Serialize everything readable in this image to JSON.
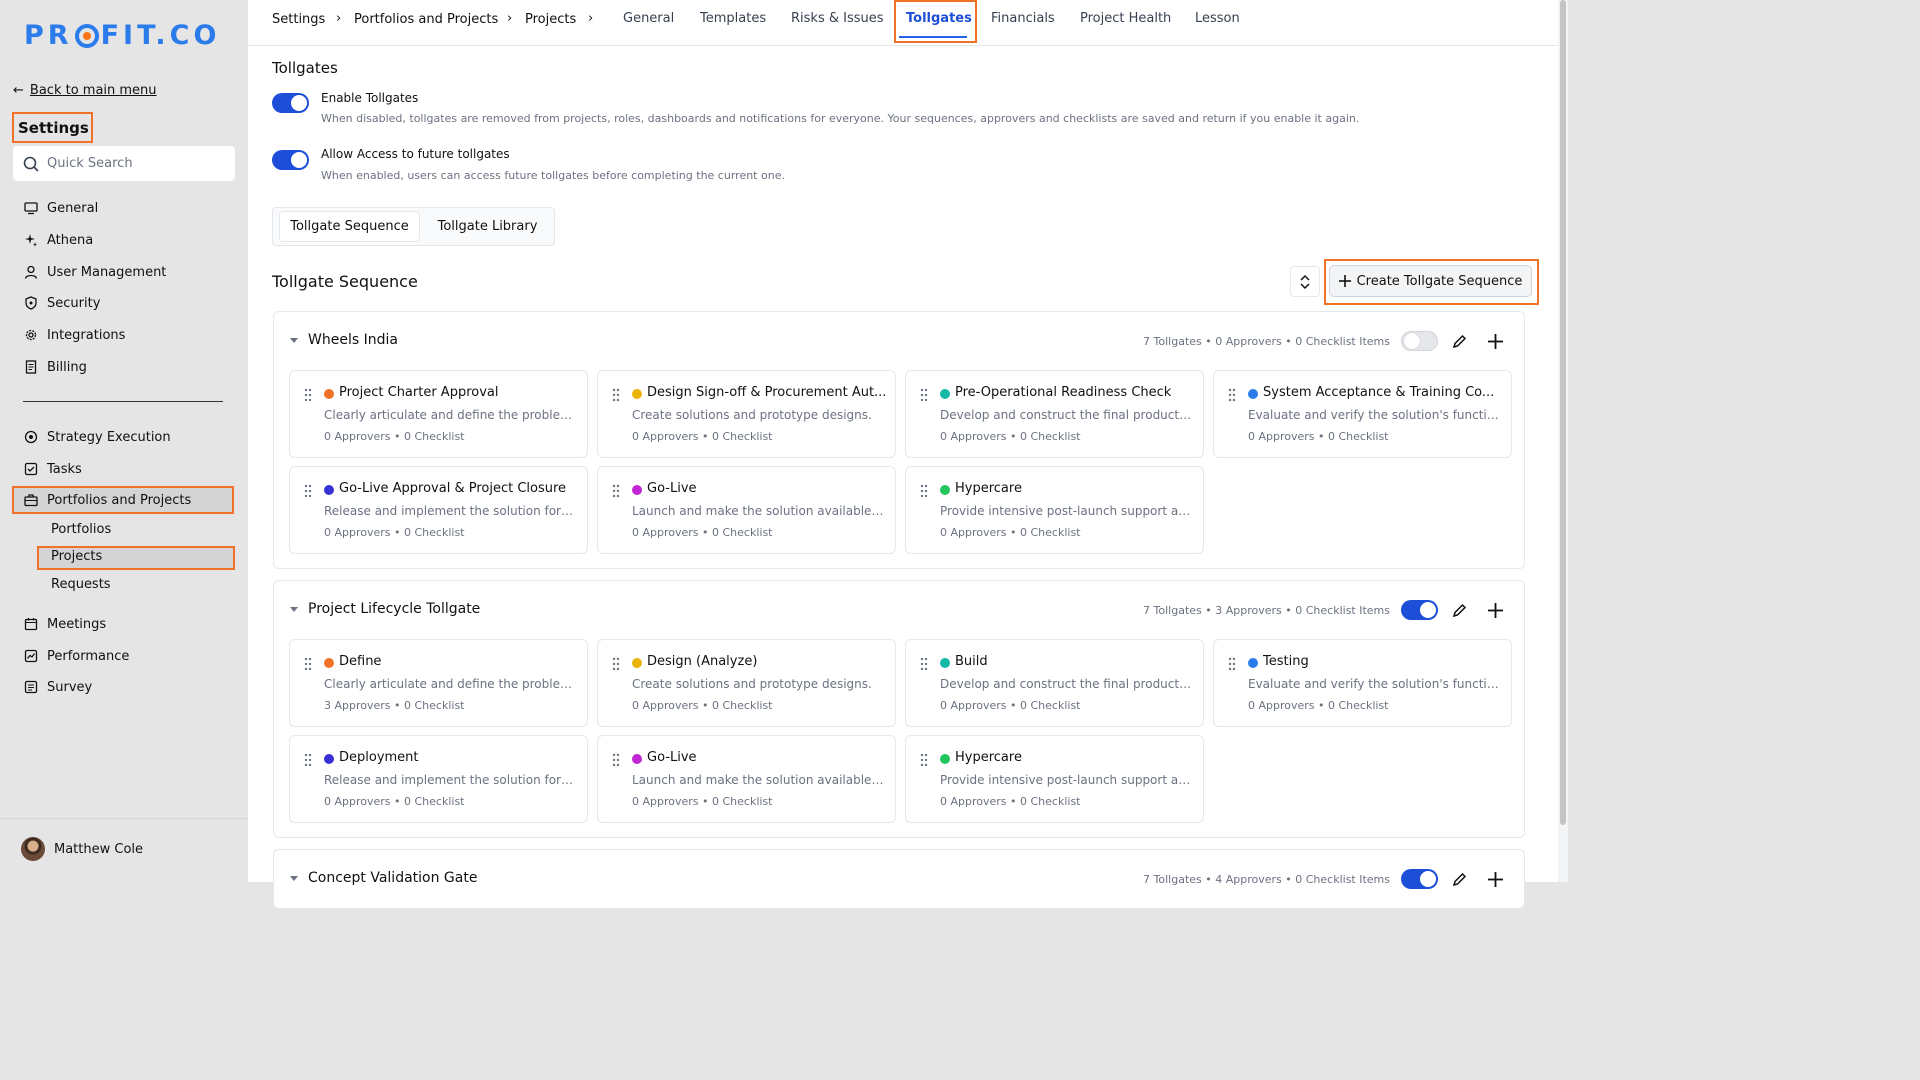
{
  "sidebar": {
    "logo": "PROFIT.CO",
    "back_label": "Back to main menu",
    "title": "Settings",
    "search_placeholder": "Quick Search",
    "items": [
      {
        "label": "General",
        "icon": "monitor-icon"
      },
      {
        "label": "Athena",
        "icon": "sparkle-icon"
      },
      {
        "label": "User Management",
        "icon": "user-icon"
      },
      {
        "label": "Security",
        "icon": "shield-icon"
      },
      {
        "label": "Integrations",
        "icon": "gear-icon"
      },
      {
        "label": "Billing",
        "icon": "receipt-icon"
      }
    ],
    "items2": [
      {
        "label": "Strategy Execution",
        "icon": "target-icon"
      },
      {
        "label": "Tasks",
        "icon": "checkbox-icon"
      },
      {
        "label": "Portfolios and Projects",
        "icon": "briefcase-icon"
      }
    ],
    "subitems": [
      "Portfolios",
      "Projects",
      "Requests"
    ],
    "items3": [
      {
        "label": "Meetings",
        "icon": "calendar-icon"
      },
      {
        "label": "Performance",
        "icon": "chart-icon"
      },
      {
        "label": "Survey",
        "icon": "survey-icon"
      }
    ],
    "user_name": "Matthew Cole"
  },
  "breadcrumb": [
    "Settings",
    "Portfolios and Projects",
    "Projects"
  ],
  "tabs": [
    "General",
    "Templates",
    "Risks & Issues",
    "Tollgates",
    "Financials",
    "Project Health",
    "Lesson"
  ],
  "active_tab": "Tollgates",
  "page": {
    "title": "Tollgates",
    "options": [
      {
        "title": "Enable Tollgates",
        "desc": "When disabled, tollgates are removed from projects, roles, dashboards and notifications for everyone. Your sequences, approvers and checklists are saved and return if you enable it again.",
        "enabled": true
      },
      {
        "title": "Allow Access to future tollgates",
        "desc": "When enabled, users can access future tollgates before completing the current one.",
        "enabled": true
      }
    ],
    "segments": [
      "Tollgate Sequence",
      "Tollgate Library"
    ],
    "section_title": "Tollgate Sequence",
    "create_label": "Create Tollgate Sequence"
  },
  "sequences": [
    {
      "name": "Wheels India",
      "meta": "7 Tollgates • 0 Approvers • 0 Checklist Items",
      "enabled": false,
      "tollgates": [
        {
          "name": "Project Charter Approval",
          "desc": "Clearly articulate and define the problem o...",
          "stats": "0 Approvers • 0 Checklist",
          "color": "#f07226"
        },
        {
          "name": "Design Sign-off & Procurement Aut...",
          "desc": "Create solutions and prototype designs.",
          "stats": "0 Approvers • 0 Checklist",
          "color": "#eab308"
        },
        {
          "name": "Pre-Operational Readiness Check",
          "desc": "Develop and construct the final product or...",
          "stats": "0 Approvers • 0 Checklist",
          "color": "#14b8a6"
        },
        {
          "name": "System Acceptance & Training Co...",
          "desc": "Evaluate and verify the solution's functiona...",
          "stats": "0 Approvers • 0 Checklist",
          "color": "#2b7bea"
        },
        {
          "name": "Go-Live Approval & Project Closure",
          "desc": "Release and implement the solution for en...",
          "stats": "0 Approvers • 0 Checklist",
          "color": "#3730d4"
        },
        {
          "name": "Go-Live",
          "desc": "Launch and make the solution available to ...",
          "stats": "0 Approvers • 0 Checklist",
          "color": "#c026d3"
        },
        {
          "name": "Hypercare",
          "desc": "Provide intensive post-launch support and...",
          "stats": "0 Approvers • 0 Checklist",
          "color": "#22c55e"
        }
      ]
    },
    {
      "name": "Project Lifecycle Tollgate",
      "meta": "7 Tollgates • 3 Approvers • 0 Checklist Items",
      "enabled": true,
      "tollgates": [
        {
          "name": "Define",
          "desc": "Clearly articulate and define the problem o...",
          "stats": "3 Approvers • 0 Checklist",
          "color": "#f07226"
        },
        {
          "name": "Design (Analyze)",
          "desc": "Create solutions and prototype designs.",
          "stats": "0 Approvers • 0 Checklist",
          "color": "#eab308"
        },
        {
          "name": "Build",
          "desc": "Develop and construct the final product or...",
          "stats": "0 Approvers • 0 Checklist",
          "color": "#14b8a6"
        },
        {
          "name": "Testing",
          "desc": "Evaluate and verify the solution's functiona...",
          "stats": "0 Approvers • 0 Checklist",
          "color": "#2b7bea"
        },
        {
          "name": "Deployment",
          "desc": "Release and implement the solution for en...",
          "stats": "0 Approvers • 0 Checklist",
          "color": "#3730d4"
        },
        {
          "name": "Go-Live",
          "desc": "Launch and make the solution available to ...",
          "stats": "0 Approvers • 0 Checklist",
          "color": "#c026d3"
        },
        {
          "name": "Hypercare",
          "desc": "Provide intensive post-launch support and...",
          "stats": "0 Approvers • 0 Checklist",
          "color": "#22c55e"
        }
      ]
    },
    {
      "name": "Concept Validation Gate",
      "meta": "7 Tollgates • 4 Approvers • 0 Checklist Items",
      "enabled": true,
      "tollgates": []
    }
  ],
  "colors": {
    "accent": "#1d4ed8",
    "highlight": "#f07226",
    "brand": "#2b7bea"
  }
}
